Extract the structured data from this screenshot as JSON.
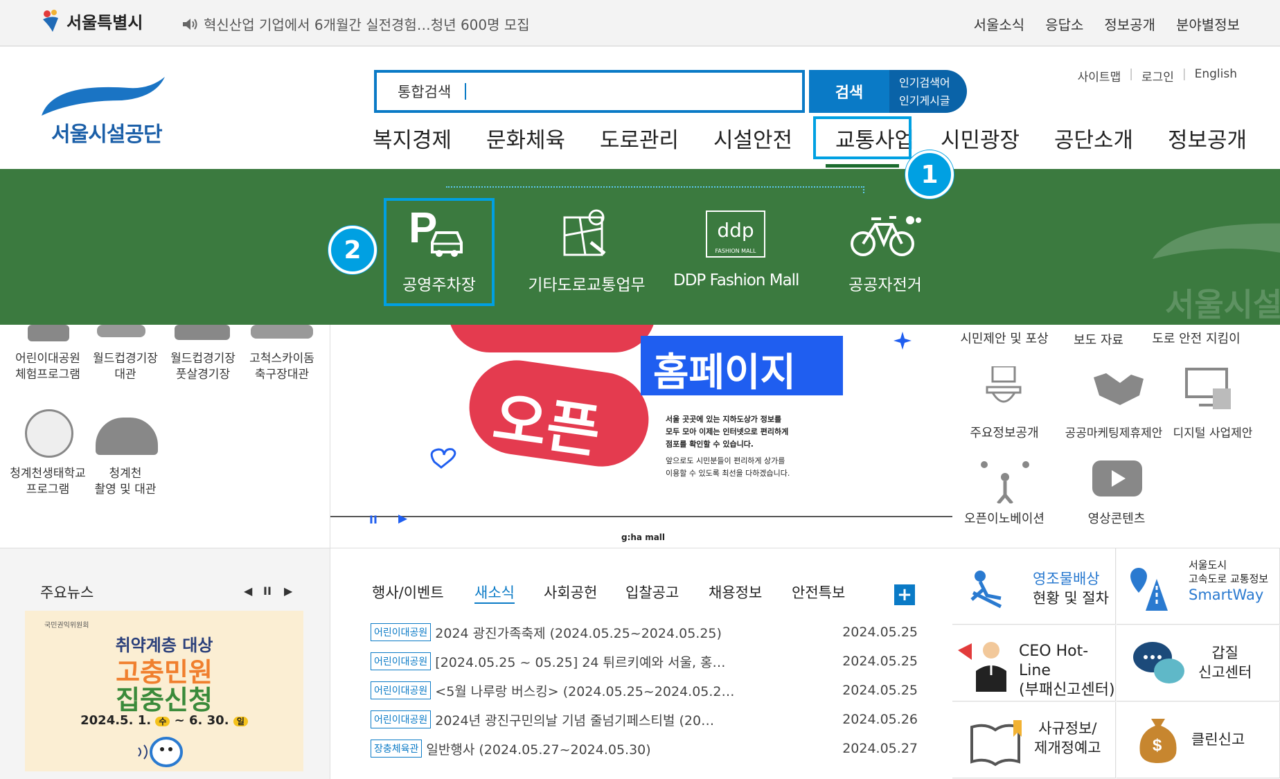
{
  "topbar": {
    "logo_text": "서울특별시",
    "notice": "혁신산업 기업에서 6개월간 실전경험…청년 600명 모집",
    "links": [
      "서울소식",
      "응답소",
      "정보공개",
      "분야별정보"
    ]
  },
  "header": {
    "logo_text": "서울시설공단",
    "search_label": "통합검색",
    "search_button": "검색",
    "popular_1": "인기검색어",
    "popular_2": "인기게시글",
    "sub_links": [
      "사이트맵",
      "로그인",
      "English"
    ],
    "gnb": [
      "복지경제",
      "문화체육",
      "도로관리",
      "시설안전",
      "교통사업",
      "시민광장",
      "공단소개",
      "정보공개"
    ],
    "badge_1": "1",
    "badge_2": "2"
  },
  "dropdown": {
    "items": [
      "공영주차장",
      "기타도로교통업무",
      "DDP Fashion Mall",
      "공공자전거"
    ],
    "ddp_logo": "ddp",
    "ddp_sub": "FASHION MALL",
    "watermark": "서울시설"
  },
  "left_icons": [
    {
      "l1": "어린이대공원",
      "l2": "체험프로그램"
    },
    {
      "l1": "월드컵경기장",
      "l2": "대관"
    },
    {
      "l1": "월드컵경기장",
      "l2": "풋살경기장"
    },
    {
      "l1": "고척스카이돔",
      "l2": "축구장대관"
    },
    {
      "l1": "청계천생태학교",
      "l2": "프로그램"
    },
    {
      "l1": "청계천",
      "l2": "촬영 및 대관"
    }
  ],
  "banner": {
    "word1": "오픈",
    "word2": "홈페이지",
    "desc1": "서울 곳곳에 있는 지하도상가 정보를",
    "desc2": "모두 모아 이제는 인터넷으로 편리하게",
    "desc3": "점포를 확인할 수 있습니다.",
    "desc4": "앞으로도 시민분들이 편리하게 상가를",
    "desc5": "이용할 수 있도록 최선을 다하겠습니다.",
    "footer": "g:ha mall",
    "pause": "II",
    "play": "▶"
  },
  "right_icons": [
    "시민제안 및 포상",
    "보도 자료",
    "도로 안전 지킴이",
    "주요정보공개",
    "공공마케팅제휴제안",
    "디지털 사업제안",
    "오픈이노베이션",
    "영상콘텐츠"
  ],
  "news": {
    "title": "주요뉴스",
    "poster_org": "국민권익위원회",
    "poster_l1": "취약계층 대상",
    "poster_l2": "고충민원",
    "poster_l3": "집중신청",
    "poster_date_a": "2024.5. 1.",
    "poster_day_a": "수",
    "poster_date_b": "~ 6. 30.",
    "poster_day_b": "일"
  },
  "board": {
    "tabs": [
      "행사/이벤트",
      "새소식",
      "사회공헌",
      "입찰공고",
      "채용정보",
      "안전특보"
    ],
    "active_tab": 1,
    "plus": "+",
    "rows": [
      {
        "tag": "어린이대공원",
        "title": "2024 광진가족축제 (2024.05.25~2024.05.25)",
        "date": "2024.05.25"
      },
      {
        "tag": "어린이대공원",
        "title": "[2024.05.25 ~ 05.25] 24 튀르키예와 서울, 홍…",
        "date": "2024.05.25"
      },
      {
        "tag": "어린이대공원",
        "title": "<5월 나루랑 버스킹> (2024.05.25~2024.05.2…",
        "date": "2024.05.25"
      },
      {
        "tag": "어린이대공원",
        "title": "2024년 광진구민의날 기념 줄넘기페스티벌 (20…",
        "date": "2024.05.26"
      },
      {
        "tag": "장충체육관",
        "title": "일반행사 (2024.05.27~2024.05.30)",
        "date": "2024.05.27"
      }
    ]
  },
  "quick": {
    "q1a": "영조물배상",
    "q1b": "현황 및 절차",
    "q2a": "서울도시",
    "q2b": "고속도로 교통정보",
    "q2c": "SmartWay",
    "q3a": "CEO Hot-Line",
    "q3b": "(부패신고센터)",
    "q4a": "갑질",
    "q4b": "신고센터",
    "q5a": "사규정보/",
    "q5b": "제개정예고",
    "q6a": "클린신고"
  },
  "colors": {
    "accent": "#0a7ac6",
    "highlight": "#00a0e2",
    "dropdown": "#3b7a3f",
    "banner_red": "#e43b4f",
    "banner_blue": "#1f5ef0"
  }
}
